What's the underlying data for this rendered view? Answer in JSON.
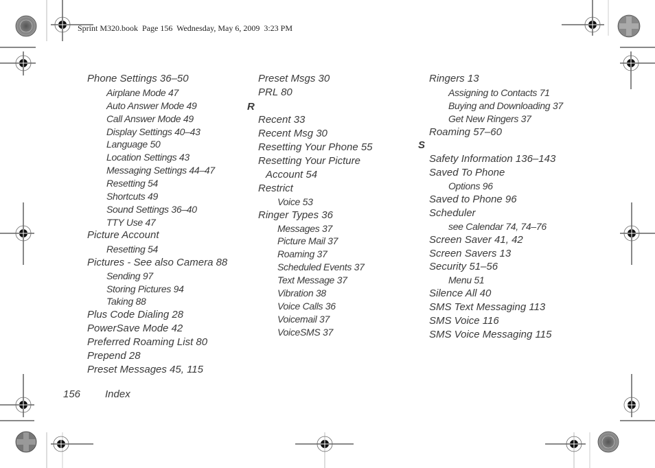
{
  "header": {
    "slug": "Sprint M320.book  Page 156  Wednesday, May 6, 2009  3:23 PM"
  },
  "footer": {
    "page_number": "156",
    "section_title": "Index"
  },
  "columns": [
    {
      "entries": [
        {
          "text": "Phone Settings 36–50",
          "level": 1
        },
        {
          "text": "Airplane Mode 47",
          "level": 2
        },
        {
          "text": "Auto Answer Mode 49",
          "level": 2
        },
        {
          "text": "Call Answer Mode 49",
          "level": 2
        },
        {
          "text": "Display Settings 40–43",
          "level": 2
        },
        {
          "text": "Language 50",
          "level": 2
        },
        {
          "text": "Location Settings 43",
          "level": 2
        },
        {
          "text": "Messaging Settings 44–47",
          "level": 2
        },
        {
          "text": "Resetting 54",
          "level": 2
        },
        {
          "text": "Shortcuts 49",
          "level": 2
        },
        {
          "text": "Sound Settings 36–40",
          "level": 2
        },
        {
          "text": "TTY Use 47",
          "level": 2
        },
        {
          "text": "Picture Account",
          "level": 1
        },
        {
          "text": "Resetting 54",
          "level": 2
        },
        {
          "text": "Pictures - See also Camera 88",
          "level": 1
        },
        {
          "text": "Sending 97",
          "level": 2
        },
        {
          "text": "Storing Pictures 94",
          "level": 2
        },
        {
          "text": "Taking 88",
          "level": 2
        },
        {
          "text": "Plus Code Dialing 28",
          "level": 1
        },
        {
          "text": "PowerSave Mode 42",
          "level": 1
        },
        {
          "text": "Preferred Roaming List 80",
          "level": 1
        },
        {
          "text": "Prepend 28",
          "level": 1
        },
        {
          "text": "Preset Messages 45, 115",
          "level": 1
        }
      ]
    },
    {
      "entries": [
        {
          "text": "Preset Msgs 30",
          "level": 1
        },
        {
          "text": "PRL 80",
          "level": 1
        },
        {
          "text": "R",
          "level": 0
        },
        {
          "text": "Recent 33",
          "level": 1
        },
        {
          "text": "Recent Msg 30",
          "level": 1
        },
        {
          "text": "Resetting Your Phone 55",
          "level": 1
        },
        {
          "text": "Resetting Your Picture",
          "level": 1
        },
        {
          "text": "Account 54",
          "level": 1.5
        },
        {
          "text": "Restrict",
          "level": 1
        },
        {
          "text": "Voice 53",
          "level": 2
        },
        {
          "text": "Ringer Types 36",
          "level": 1
        },
        {
          "text": "Messages 37",
          "level": 2
        },
        {
          "text": "Picture Mail 37",
          "level": 2
        },
        {
          "text": "Roaming 37",
          "level": 2
        },
        {
          "text": "Scheduled Events 37",
          "level": 2
        },
        {
          "text": "Text Message 37",
          "level": 2
        },
        {
          "text": "Vibration 38",
          "level": 2
        },
        {
          "text": "Voice Calls 36",
          "level": 2
        },
        {
          "text": "Voicemail 37",
          "level": 2
        },
        {
          "text": "VoiceSMS 37",
          "level": 2
        }
      ]
    },
    {
      "entries": [
        {
          "text": "Ringers 13",
          "level": 1
        },
        {
          "text": "Assigning to Contacts 71",
          "level": 2
        },
        {
          "text": "Buying and Downloading 37",
          "level": 2
        },
        {
          "text": "Get New Ringers 37",
          "level": 2
        },
        {
          "text": "Roaming 57–60",
          "level": 1
        },
        {
          "text": "S",
          "level": 0
        },
        {
          "text": "Safety Information 136–143",
          "level": 1
        },
        {
          "text": "Saved To Phone",
          "level": 1
        },
        {
          "text": "Options 96",
          "level": 2
        },
        {
          "text": "Saved to Phone 96",
          "level": 1
        },
        {
          "text": "Scheduler",
          "level": 1
        },
        {
          "text": "see Calendar 74, 74–76",
          "level": 2
        },
        {
          "text": "Screen Saver 41, 42",
          "level": 1
        },
        {
          "text": "Screen Savers 13",
          "level": 1
        },
        {
          "text": "Security 51–56",
          "level": 1
        },
        {
          "text": "Menu 51",
          "level": 2
        },
        {
          "text": "Silence All 40",
          "level": 1
        },
        {
          "text": "SMS Text Messaging 113",
          "level": 1
        },
        {
          "text": "SMS Voice 116",
          "level": 1
        },
        {
          "text": "SMS Voice Messaging 115",
          "level": 1
        }
      ]
    }
  ]
}
